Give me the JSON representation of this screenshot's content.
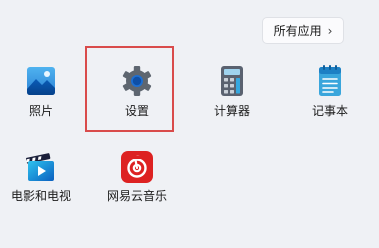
{
  "header": {
    "all_apps_label": "所有应用",
    "chevron": "›"
  },
  "apps": [
    {
      "label": "照片",
      "icon": "photos-icon"
    },
    {
      "label": "设置",
      "icon": "settings-gear-icon",
      "highlighted": true
    },
    {
      "label": "计算器",
      "icon": "calculator-icon"
    },
    {
      "label": "记事本",
      "icon": "notepad-icon"
    },
    {
      "label": "电影和电视",
      "icon": "movies-tv-icon"
    },
    {
      "label": "网易云音乐",
      "icon": "netease-music-icon"
    }
  ],
  "colors": {
    "background": "#eff1f5",
    "highlight_border": "#d94b4b",
    "music_red": "#dd2222"
  }
}
